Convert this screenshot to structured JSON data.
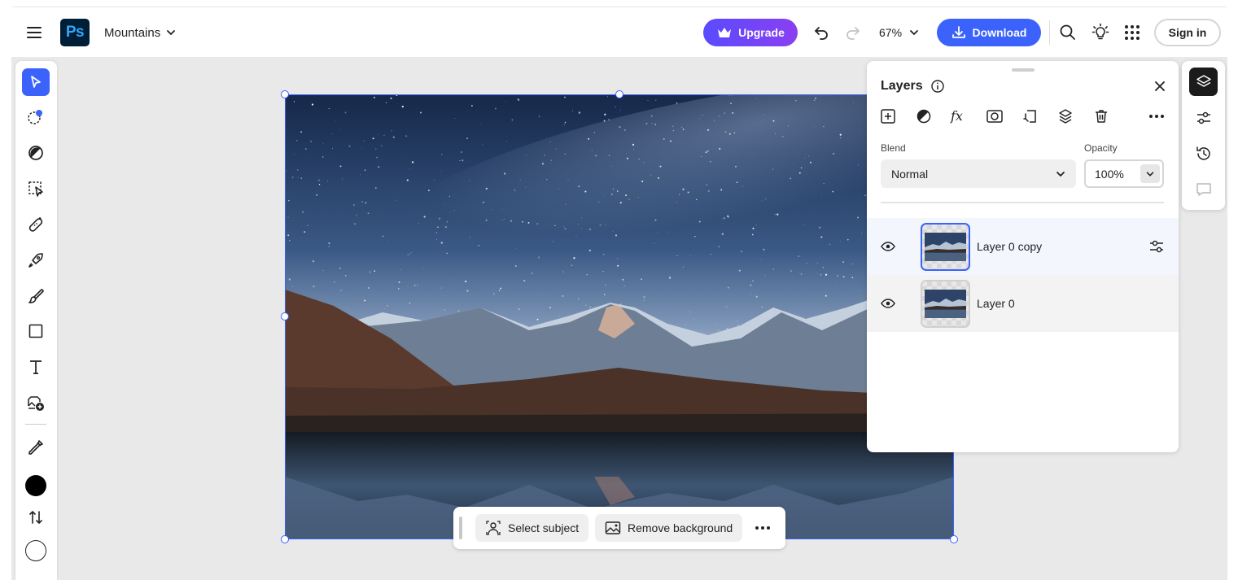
{
  "header": {
    "app_logo_text": "Ps",
    "document_title": "Mountains",
    "upgrade_label": "Upgrade",
    "zoom_level": "67%",
    "download_label": "Download",
    "signin_label": "Sign in"
  },
  "toolbar": {
    "tools": [
      "select-tool",
      "quick-select-tool",
      "adjustment-brush-tool",
      "object-select-tool",
      "spot-heal-tool",
      "generative-fill-tool",
      "brush-tool",
      "shape-tool",
      "type-tool",
      "add-image-tool",
      "eyedropper-tool"
    ],
    "active_tool": "select-tool",
    "foreground_color": "#000000",
    "background_color": "#ffffff"
  },
  "taskbar": {
    "select_subject_label": "Select subject",
    "remove_background_label": "Remove background"
  },
  "layers_panel": {
    "title": "Layers",
    "toolbar_icons": [
      "add-layer-icon",
      "adjustment-layer-icon",
      "fx-icon",
      "mask-icon",
      "clip-icon",
      "stack-icon",
      "trash-icon",
      "more-icon"
    ],
    "blend_label": "Blend",
    "blend_value": "Normal",
    "opacity_label": "Opacity",
    "opacity_value": "100%",
    "layers": [
      {
        "name": "Layer 0 copy",
        "visible": true,
        "selected": true
      },
      {
        "name": "Layer 0",
        "visible": true,
        "selected": false
      }
    ]
  },
  "right_rail": {
    "buttons": [
      "layers-icon",
      "adjustments-icon",
      "history-icon",
      "comments-icon"
    ],
    "active": "layers-icon"
  },
  "colors": {
    "accent_blue": "#3b63fb",
    "upgrade_gradient_start": "#5a4bff",
    "upgrade_gradient_end": "#8a3ff0",
    "ps_logo_bg": "#001e36",
    "ps_logo_text": "#31a8ff"
  }
}
